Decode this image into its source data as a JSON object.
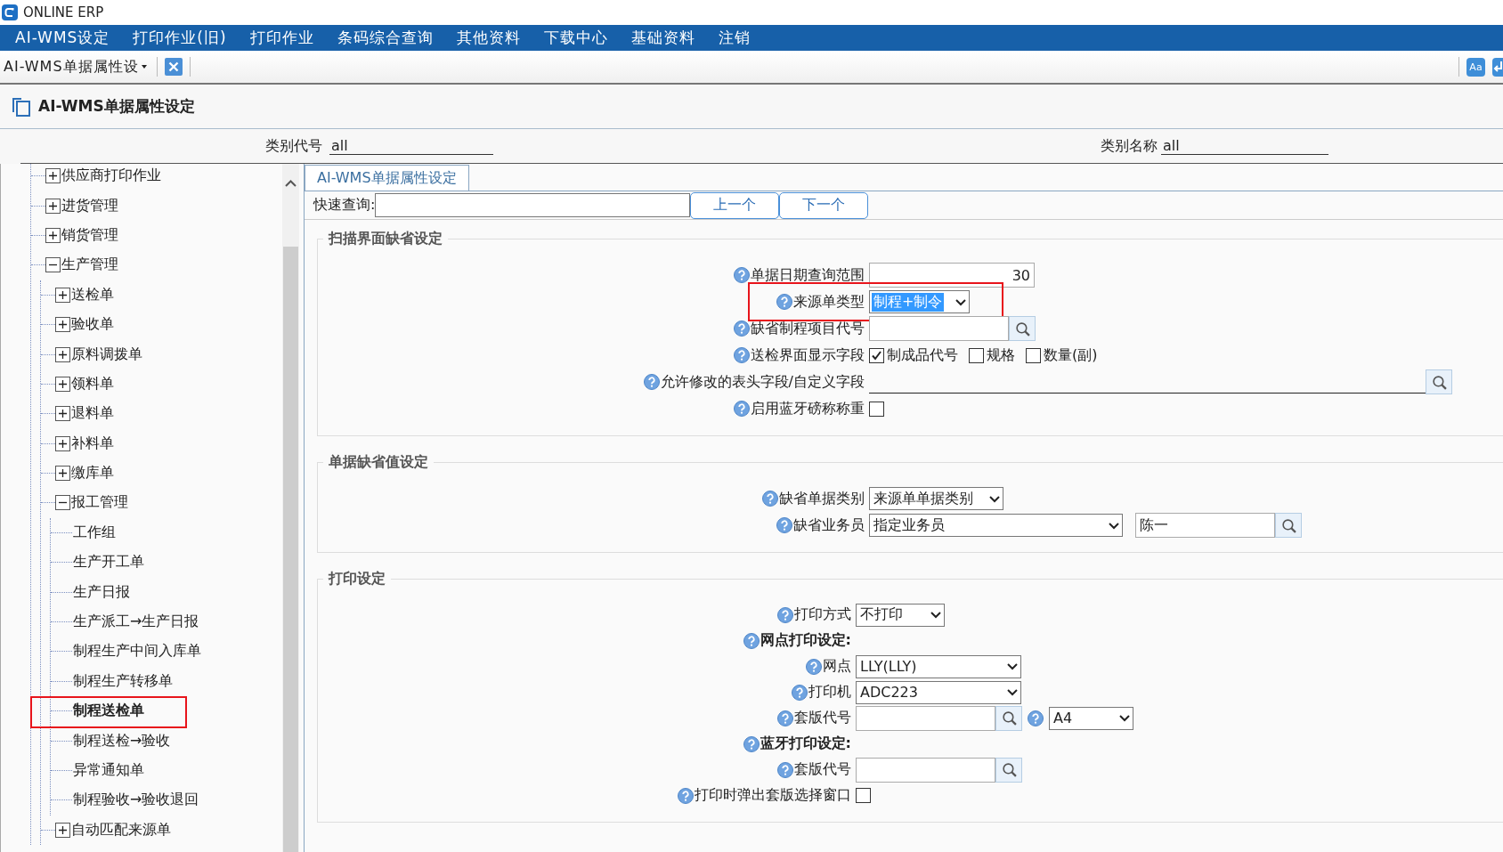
{
  "window": {
    "title": "ONLINE ERP"
  },
  "menu": [
    {
      "label": "AI-WMS设定"
    },
    {
      "label": "打印作业(旧)"
    },
    {
      "label": "打印作业"
    },
    {
      "label": "条码综合查询"
    },
    {
      "label": "其他资料"
    },
    {
      "label": "下载中心"
    },
    {
      "label": "基础资料"
    },
    {
      "label": "注销"
    }
  ],
  "doc_tab": {
    "label": "AI-WMS单据属性设",
    "font_label": "Aa"
  },
  "page_title": "AI-WMS单据属性设定",
  "category": {
    "code_label": "类别代号",
    "code_value": "all",
    "name_label": "类别名称",
    "name_value": "all"
  },
  "tree": {
    "items": [
      {
        "label": "供应商打印作业",
        "expanded": false,
        "selected": false,
        "highlighted": false
      },
      {
        "label": "进货管理",
        "expanded": false,
        "selected": false,
        "highlighted": false
      },
      {
        "label": "销货管理",
        "expanded": false,
        "selected": false,
        "highlighted": false
      },
      {
        "label": "生产管理",
        "expanded": true,
        "selected": false,
        "highlighted": false,
        "children": [
          {
            "label": "送检单",
            "expanded": false,
            "selected": false,
            "highlighted": false
          },
          {
            "label": "验收单",
            "expanded": false,
            "selected": false,
            "highlighted": false
          },
          {
            "label": "原料调拨单",
            "expanded": false,
            "selected": false,
            "highlighted": false
          },
          {
            "label": "领料单",
            "expanded": false,
            "selected": false,
            "highlighted": false
          },
          {
            "label": "退料单",
            "expanded": false,
            "selected": false,
            "highlighted": false
          },
          {
            "label": "补料单",
            "expanded": false,
            "selected": false,
            "highlighted": false
          },
          {
            "label": "缴库单",
            "expanded": false,
            "selected": false,
            "highlighted": false
          },
          {
            "label": "报工管理",
            "expanded": true,
            "selected": false,
            "highlighted": false,
            "children": [
              {
                "label": "工作组",
                "selected": false,
                "highlighted": false
              },
              {
                "label": "生产开工单",
                "selected": false,
                "highlighted": false
              },
              {
                "label": "生产日报",
                "selected": false,
                "highlighted": false
              },
              {
                "label": "生产派工→生产日报",
                "selected": false,
                "highlighted": false
              },
              {
                "label": "制程生产中间入库单",
                "selected": false,
                "highlighted": false
              },
              {
                "label": "制程生产转移单",
                "selected": false,
                "highlighted": false
              },
              {
                "label": "制程送检单",
                "selected": true,
                "highlighted": true
              },
              {
                "label": "制程送检→验收",
                "selected": false,
                "highlighted": false
              },
              {
                "label": "异常通知单",
                "selected": false,
                "highlighted": false
              },
              {
                "label": "制程验收→验收退回",
                "selected": false,
                "highlighted": false
              }
            ]
          },
          {
            "label": "自动匹配来源单",
            "expanded": false,
            "selected": false,
            "highlighted": false
          }
        ]
      }
    ]
  },
  "form": {
    "tab": {
      "label": "AI-WMS单据属性设定",
      "selected": true
    },
    "quick_search": {
      "label": "快速查询:",
      "prev": "上一个",
      "next": "下一个"
    },
    "groups": [
      {
        "title": "扫描界面缺省设定",
        "rows": [
          {
            "kind": "number",
            "label": "单据日期查询范围",
            "value": "30"
          },
          {
            "kind": "select",
            "label": "来源单类型",
            "value": "制程+制令",
            "focused": true,
            "highlighted": true
          },
          {
            "kind": "lookup",
            "label": "缺省制程项目代号"
          },
          {
            "kind": "checks",
            "label": "送检界面显示字段",
            "options": [
              {
                "label": "制成品代号",
                "checked": true
              },
              {
                "label": "规格",
                "checked": false
              },
              {
                "label": "数量(副)",
                "checked": false
              }
            ]
          },
          {
            "kind": "longlookup",
            "label": "允许修改的表头字段/自定义字段"
          },
          {
            "kind": "checkbox",
            "label": "启用蓝牙磅称称重",
            "checked": false
          }
        ]
      },
      {
        "title": "单据缺省值设定",
        "rows": [
          {
            "kind": "select",
            "label": "缺省单据类别",
            "value": "来源单单据类别",
            "focused": false,
            "highlighted": false
          },
          {
            "kind": "selectlookup",
            "label": "缺省业务员",
            "value": "指定业务员",
            "lookup_value": "陈一"
          }
        ]
      },
      {
        "title": "打印设定",
        "rows": [
          {
            "kind": "select",
            "label": "打印方式",
            "value": "不打印",
            "focused": false,
            "highlighted": false
          },
          {
            "kind": "heading",
            "label": "网点打印设定:"
          },
          {
            "kind": "select",
            "label": "网点",
            "value": "LLY(LLY)",
            "focused": false,
            "highlighted": false
          },
          {
            "kind": "select",
            "label": "打印机",
            "value": "ADC223",
            "focused": false,
            "highlighted": false
          },
          {
            "kind": "lookupselect",
            "label": "套版代号",
            "value": "A4"
          },
          {
            "kind": "heading",
            "label": "蓝牙打印设定:"
          },
          {
            "kind": "lookup",
            "label": "套版代号"
          },
          {
            "kind": "checkbox",
            "label": "打印时弹出套版选择窗口",
            "checked": false
          }
        ]
      }
    ]
  }
}
